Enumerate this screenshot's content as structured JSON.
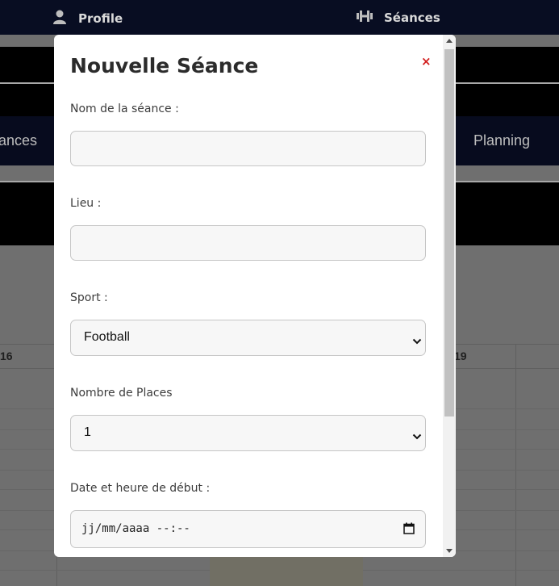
{
  "topnav": {
    "profile_label": "Profile",
    "seances_label": "Séances",
    "profile_icon": "user-icon",
    "seances_icon": "dumbbell-icon"
  },
  "subnav": {
    "left_label": "ances",
    "right_label": "Planning"
  },
  "calendar": {
    "day_left": "16",
    "day_right": "19"
  },
  "modal": {
    "title": "Nouvelle Séance",
    "close_label": "×",
    "fields": {
      "name": {
        "label": "Nom de la séance :",
        "value": ""
      },
      "place": {
        "label": "Lieu :",
        "value": ""
      },
      "sport": {
        "label": "Sport :",
        "value": "Football"
      },
      "places": {
        "label": "Nombre de Places",
        "value": "1"
      },
      "start": {
        "label": "Date et heure de début :",
        "value": "jj/mm/aaaa --:--"
      }
    }
  },
  "colors": {
    "nav_bg": "#080d22",
    "close_red": "#d21e1e",
    "field_bg": "#f7f7f7"
  }
}
